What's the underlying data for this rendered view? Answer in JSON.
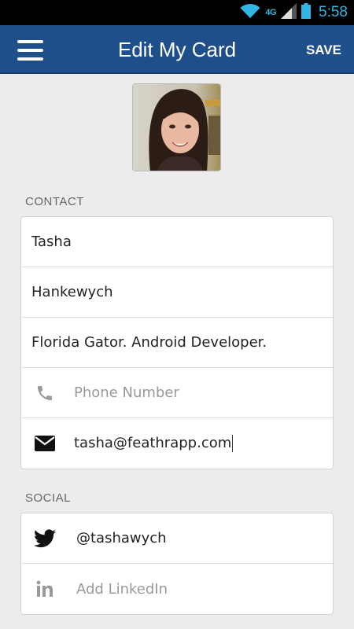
{
  "status_bar": {
    "network": "4G",
    "time": "5:58"
  },
  "app_bar": {
    "title": "Edit My Card",
    "save_label": "SAVE"
  },
  "contact": {
    "section_label": "CONTACT",
    "first_name": "Tasha",
    "last_name": "Hankewych",
    "headline": "Florida Gator. Android Developer.",
    "phone_placeholder": "Phone Number",
    "email": "tasha@feathrapp.com"
  },
  "social": {
    "section_label": "SOCIAL",
    "twitter": "@tashawych",
    "linkedin_placeholder": "Add LinkedIn"
  },
  "colors": {
    "app_bar": "#1f4f8a",
    "status_accent": "#33b5e5",
    "background": "#ececec"
  },
  "icons": [
    "menu-icon",
    "phone-icon",
    "email-icon",
    "twitter-icon",
    "linkedin-icon",
    "wifi-icon",
    "signal-icon",
    "battery-icon"
  ]
}
